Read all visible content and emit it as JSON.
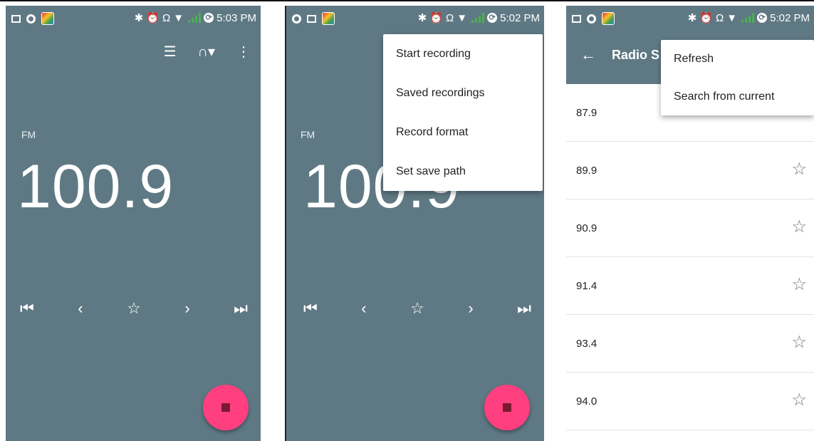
{
  "screen1": {
    "status_time": "5:03 PM",
    "band": "FM",
    "frequency": "100.9"
  },
  "screen2": {
    "status_time": "5:02 PM",
    "band": "FM",
    "frequency": "100.9",
    "menu_items": [
      "Start recording",
      "Saved recordings",
      "Record format",
      "Set save path"
    ]
  },
  "screen3": {
    "status_time": "5:02 PM",
    "title": "Radio S",
    "menu_items": [
      "Refresh",
      "Search from current"
    ],
    "stations": [
      "87.9",
      "89.9",
      "90.9",
      "91.4",
      "93.4",
      "94.0"
    ]
  },
  "icons": {
    "prev_station": "skip-previous-icon",
    "seek_back": "chevron-left-icon",
    "favorite": "star-outline-icon",
    "seek_forward": "chevron-right-icon",
    "next_station": "skip-next-icon",
    "stop": "stop-icon"
  },
  "colors": {
    "background": "#5f7984",
    "fab": "#ff3f7f"
  }
}
